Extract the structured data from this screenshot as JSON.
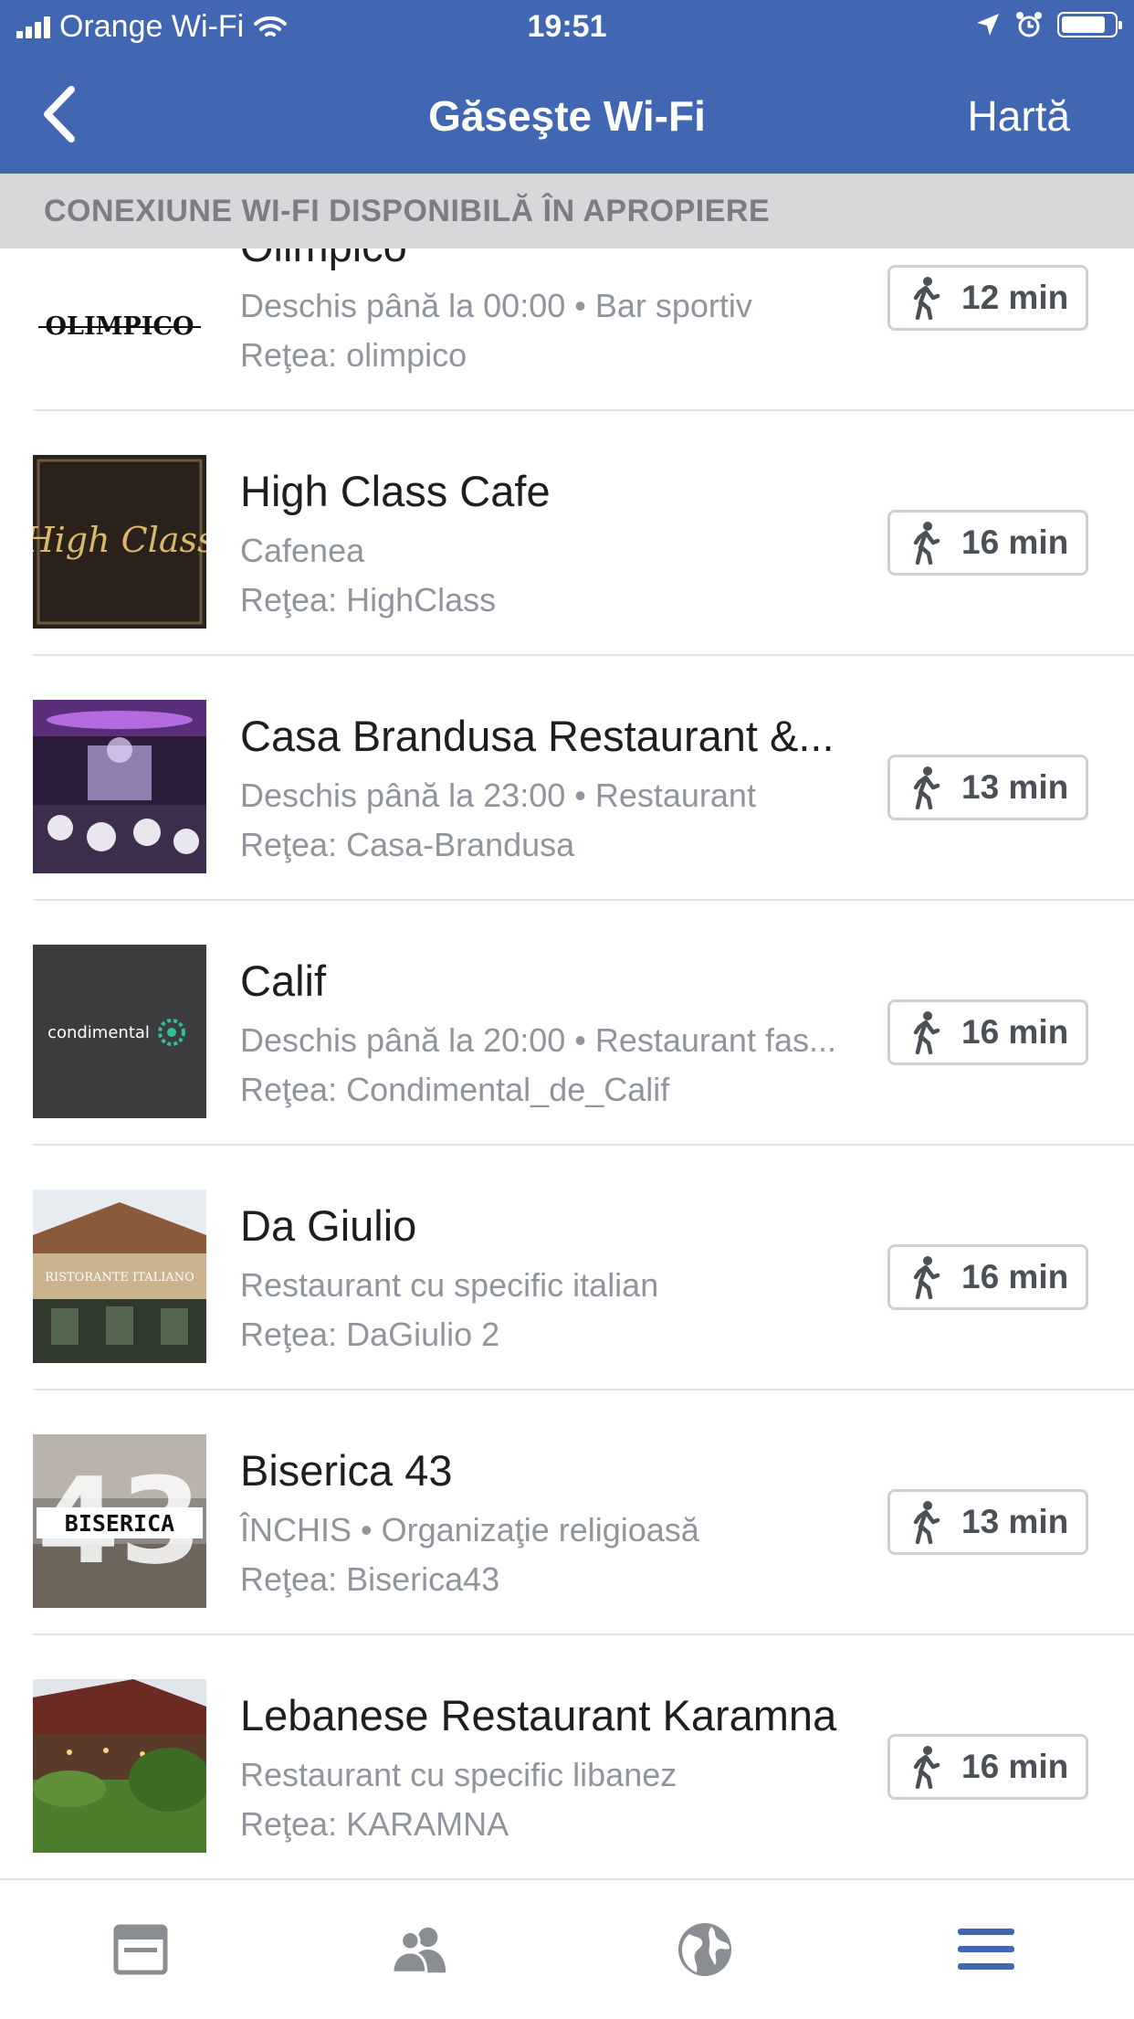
{
  "status_bar": {
    "carrier": "Orange Wi-Fi",
    "time": "19:51"
  },
  "nav": {
    "title": "Găseşte Wi-Fi",
    "map_label": "Hartă"
  },
  "section_header": "CONEXIUNE WI-FI DISPONIBILĂ ÎN APROPIERE",
  "places": [
    {
      "name": "Olimpico",
      "subtitle": "Deschis până la 00:00 • Bar sportiv",
      "network": "Reţea: olimpico",
      "walk_time": "12 min",
      "thumb_text": "OLIMPICO"
    },
    {
      "name": "High Class Cafe",
      "subtitle": "Cafenea",
      "network": "Reţea: HighClass",
      "walk_time": "16 min",
      "thumb_text": "High Class"
    },
    {
      "name": "Casa Brandusa Restaurant &...",
      "subtitle": "Deschis până la 23:00 • Restaurant",
      "network": "Reţea: Casa-Brandusa",
      "walk_time": "13 min",
      "thumb_text": ""
    },
    {
      "name": "Calif",
      "subtitle": "Deschis până la 20:00 • Restaurant fas...",
      "network": "Reţea: Condimental_de_Calif",
      "walk_time": "16 min",
      "thumb_text": "condimental"
    },
    {
      "name": "Da Giulio",
      "subtitle": "Restaurant cu specific italian",
      "network": "Reţea: DaGiulio 2",
      "walk_time": "16 min",
      "thumb_text": "RISTORANTE ITALIANO"
    },
    {
      "name": "Biserica 43",
      "subtitle": "ÎNCHIS • Organizaţie religioasă",
      "network": "Reţea: Biserica43",
      "walk_time": "13 min",
      "thumb_text": "BISERICA"
    },
    {
      "name": "Lebanese Restaurant Karamna",
      "subtitle": "Restaurant cu specific libanez",
      "network": "Reţea: KARAMNA",
      "walk_time": "16 min",
      "thumb_text": ""
    }
  ],
  "tab_bar": {
    "tabs": [
      "news-feed-icon",
      "friends-icon",
      "globe-icon",
      "menu-icon"
    ],
    "active": "menu-icon"
  },
  "colors": {
    "brand_blue": "#4267b2",
    "section_gray": "#d8d8da",
    "secondary_text": "#90949c"
  }
}
